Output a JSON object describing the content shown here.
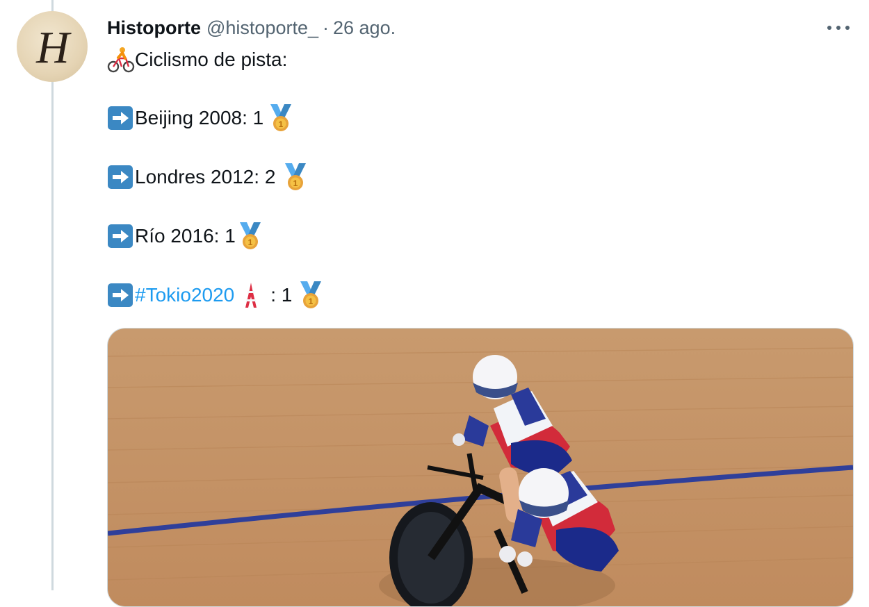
{
  "tweet": {
    "author": {
      "display_name": "Histoporte",
      "handle": "@histoporte_",
      "avatar_letter": "H"
    },
    "separator": "·",
    "timestamp": "26 ago.",
    "more_icon": "more-horizontal-icon",
    "lines": [
      {
        "icon": "bicyclist-emoji",
        "text": "Ciclismo de pista:"
      },
      {
        "icon": "right-arrow-emoji",
        "text": "Beijing 2008: 1",
        "after": "medal-emoji"
      },
      {
        "icon": "right-arrow-emoji",
        "text": "Londres 2012: 2",
        "after": "medal-emoji"
      },
      {
        "icon": "right-arrow-emoji",
        "text": "Río 2016: 1",
        "after": "medal-emoji"
      },
      {
        "icon": "right-arrow-emoji",
        "hashtag": "#Tokio2020",
        "tower": "tokyo-tower-emoji",
        "text": ": 1",
        "after": "medal-emoji"
      }
    ],
    "media": {
      "description_icon": "photo"
    }
  },
  "colors": {
    "hashtag": "#1d9bf0",
    "muted": "#536471",
    "thread_line": "#cfd9de",
    "arrow_emoji": "#3b88c3",
    "medal": "#e8a33a",
    "track": "#c79466"
  }
}
